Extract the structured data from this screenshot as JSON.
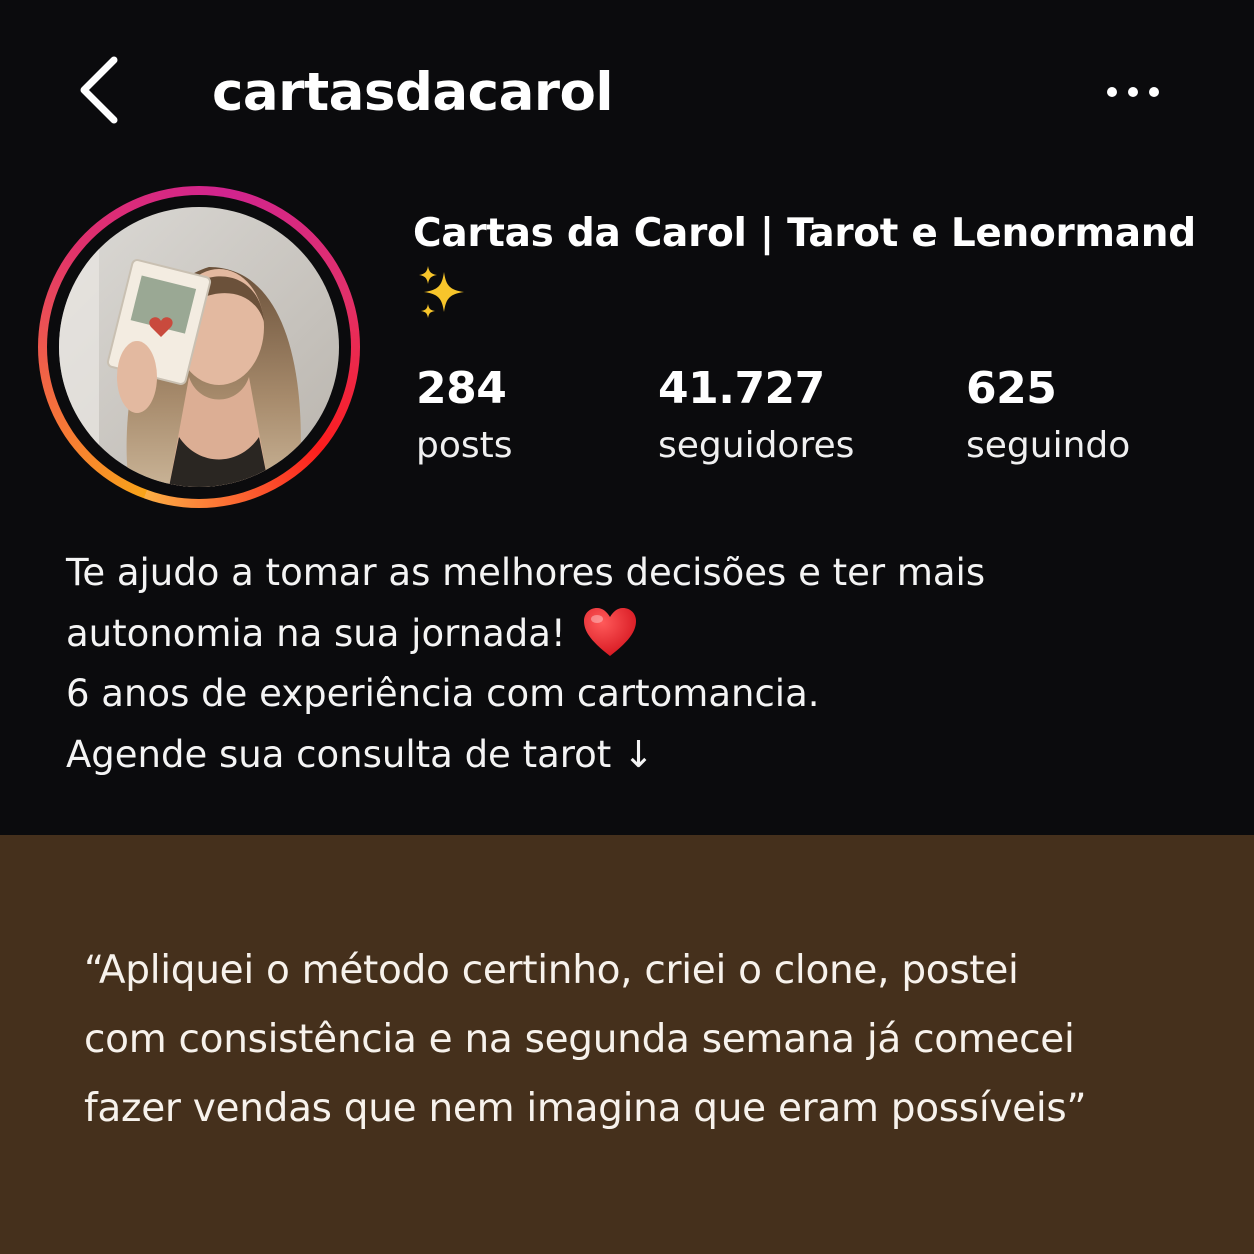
{
  "header": {
    "username": "cartasdacarol",
    "back_icon": "chevron-left-icon",
    "more_icon": "more-horizontal-icon"
  },
  "profile": {
    "display_name": "Cartas da Carol | Tarot e Lenormand",
    "display_name_emoji": "sparkles-icon",
    "stats": [
      {
        "value": "284",
        "label": "posts"
      },
      {
        "value": "41.727",
        "label": "seguidores"
      },
      {
        "value": "625",
        "label": "seguindo"
      }
    ],
    "bio": [
      "Te ajudo a tomar as melhores decisões e ter mais",
      "autonomia na sua jornada!",
      "6 anos de experiência com cartomancia.",
      "Agende sua consulta de tarot ↓"
    ],
    "bio_emoji": "red-heart-icon"
  },
  "testimonial": {
    "lines": [
      "“Apliquei o método certinho, criei o clone, postei",
      "com consistência e na segunda semana já comecei",
      "fazer vendas que nem imagina que eram possíveis”"
    ]
  },
  "colors": {
    "background": "#0b0b0d",
    "testimonial_background": "#45301c",
    "text": "#ffffff",
    "story_ring": [
      "#fcaf45",
      "#fd1d1d",
      "#e1306c",
      "#d1248f"
    ]
  }
}
